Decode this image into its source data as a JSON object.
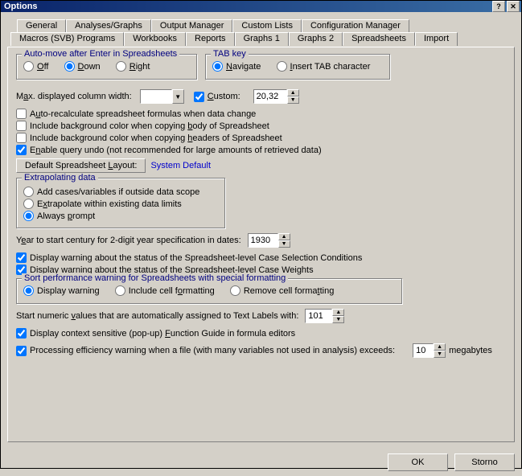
{
  "window": {
    "title": "Options",
    "help": "?",
    "close": "✕"
  },
  "tabs_row1": [
    {
      "label": "General"
    },
    {
      "label": "Analyses/Graphs"
    },
    {
      "label": "Output Manager"
    },
    {
      "label": "Custom Lists"
    },
    {
      "label": "Configuration Manager"
    }
  ],
  "tabs_row2": [
    {
      "label": "Macros (SVB) Programs"
    },
    {
      "label": "Workbooks"
    },
    {
      "label": "Reports"
    },
    {
      "label": "Graphs 1"
    },
    {
      "label": "Graphs 2"
    },
    {
      "label": "Spreadsheets",
      "active": true
    },
    {
      "label": "Import"
    }
  ],
  "automove": {
    "legend": "Auto-move after Enter in Spreadsheets",
    "off": "Off",
    "down": "Down",
    "right": "Right",
    "selected": "down"
  },
  "tabkey": {
    "legend": "TAB key",
    "navigate": "Navigate",
    "insert": "Insert TAB character",
    "selected": "navigate"
  },
  "maxwidth": {
    "label_pre": "M",
    "label_u": "a",
    "label_post": "x. displayed column width:",
    "value": "",
    "custom_u": "C",
    "custom_post": "ustom:",
    "custom_checked": true,
    "custom_value": "20,32"
  },
  "checks": {
    "autorecalc_pre": "A",
    "autorecalc_u": "u",
    "autorecalc_post": "to-recalculate spreadsheet formulas when data change",
    "autorecalc_checked": false,
    "bgbody_pre": "Include background color when copying ",
    "bgbody_u": "b",
    "bgbody_post": "ody of Spreadsheet",
    "bgbody_checked": false,
    "bghead_pre": "Include background color when copying ",
    "bghead_u": "h",
    "bghead_post": "eaders of Spreadsheet",
    "bghead_checked": false,
    "undo_pre": "E",
    "undo_u": "n",
    "undo_post": "able query undo (not recommended for large amounts of retrieved data)",
    "undo_checked": true
  },
  "layout": {
    "button_pre": "Default Spreadsheet ",
    "button_u": "L",
    "button_post": "ayout:",
    "value": "System Default"
  },
  "extrapolate": {
    "legend": "Extrapolating data",
    "opt1": "Add cases/variables if outside data scope",
    "opt2_pre": "E",
    "opt2_u": "x",
    "opt2_post": "trapolate within existing data limits",
    "opt3_pre": "Always ",
    "opt3_u": "p",
    "opt3_post": "rompt",
    "selected": "opt3"
  },
  "year": {
    "label_pre": "Y",
    "label_u": "e",
    "label_post": "ar to start century for 2-digit year specification in dates:",
    "value": "1930"
  },
  "warn_caseselect": {
    "text": "Display warning about the status of the Spreadsheet-level Case Selection Conditions",
    "checked": true
  },
  "warn_caseweight": {
    "text": "Display warning about the status of the Spreadsheet-level Case Weights",
    "checked": true
  },
  "sortperf": {
    "legend": "Sort performance warning for Spreadsheets with special formatting",
    "warn": "Display warning",
    "include_pre": "Include cell f",
    "include_u": "o",
    "include_post": "rmatting",
    "remove_pre": "Remove cell forma",
    "remove_u": "t",
    "remove_post": "ting",
    "selected": "warn"
  },
  "startnum": {
    "label_pre": "Start numeric ",
    "label_u": "v",
    "label_post": "alues that are automatically assigned to Text Labels with:",
    "value": "101"
  },
  "fnguide": {
    "pre": "Display context sensitive (pop-up) ",
    "u": "F",
    "post": "unction Guide in formula editors",
    "checked": true
  },
  "proceff": {
    "text": "Processing efficiency warning when a file (with many variables not used in analysis) exceeds:",
    "value": "10",
    "unit": "megabytes",
    "checked": true
  },
  "footer": {
    "ok": "OK",
    "storno": "Storno"
  }
}
